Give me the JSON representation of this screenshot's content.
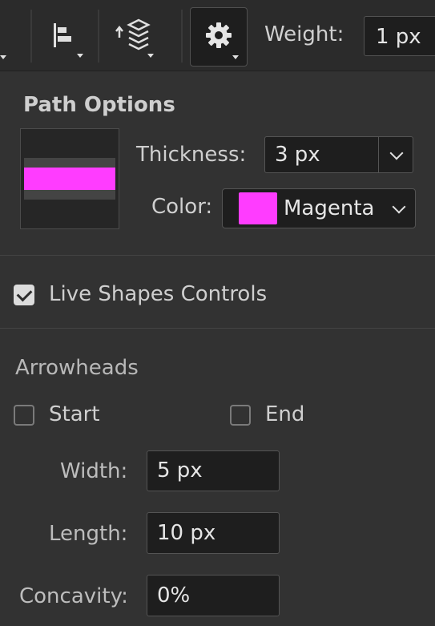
{
  "toolbar": {
    "weight_label": "Weight:",
    "weight_value": "1 px",
    "buttons": [
      {
        "icon": "align-icon"
      },
      {
        "icon": "arrange-layers-icon"
      },
      {
        "icon": "gear-icon"
      }
    ]
  },
  "path_options": {
    "title": "Path Options",
    "thickness_label": "Thickness:",
    "thickness_value": "3 px",
    "color_label": "Color:",
    "color_name": "Magenta",
    "color_hex": "#ff3cff"
  },
  "live_shapes": {
    "label": "Live Shapes Controls",
    "checked": true
  },
  "arrowheads": {
    "title": "Arrowheads",
    "start_label": "Start",
    "end_label": "End",
    "width_label": "Width:",
    "width_value": "5 px",
    "length_label": "Length:",
    "length_value": "10 px",
    "concavity_label": "Concavity:",
    "concavity_value": "0%"
  }
}
